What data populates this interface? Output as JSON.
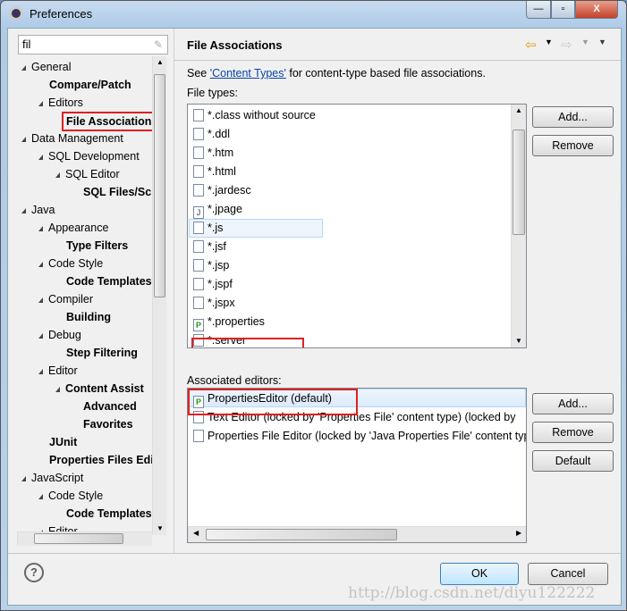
{
  "window": {
    "title": "Preferences",
    "minimize": "—",
    "maximize": "▫",
    "close": "X"
  },
  "filter": {
    "value": "fil"
  },
  "tree": [
    {
      "label": "General",
      "level": 0,
      "arrow": true,
      "bold": false
    },
    {
      "label": "Compare/Patch",
      "level": 1,
      "arrow": false,
      "bold": true
    },
    {
      "label": "Editors",
      "level": 1,
      "arrow": true,
      "bold": false
    },
    {
      "label": "File Associations",
      "level": 2,
      "arrow": false,
      "bold": true,
      "selected": true
    },
    {
      "label": "Data Management",
      "level": 0,
      "arrow": true,
      "bold": false
    },
    {
      "label": "SQL Development",
      "level": 1,
      "arrow": true,
      "bold": false
    },
    {
      "label": "SQL Editor",
      "level": 2,
      "arrow": true,
      "bold": false
    },
    {
      "label": "SQL Files/Scripts",
      "level": 3,
      "arrow": false,
      "bold": true
    },
    {
      "label": "Java",
      "level": 0,
      "arrow": true,
      "bold": false
    },
    {
      "label": "Appearance",
      "level": 1,
      "arrow": true,
      "bold": false
    },
    {
      "label": "Type Filters",
      "level": 2,
      "arrow": false,
      "bold": true
    },
    {
      "label": "Code Style",
      "level": 1,
      "arrow": true,
      "bold": false
    },
    {
      "label": "Code Templates",
      "level": 2,
      "arrow": false,
      "bold": true
    },
    {
      "label": "Compiler",
      "level": 1,
      "arrow": true,
      "bold": false
    },
    {
      "label": "Building",
      "level": 2,
      "arrow": false,
      "bold": true
    },
    {
      "label": "Debug",
      "level": 1,
      "arrow": true,
      "bold": false
    },
    {
      "label": "Step Filtering",
      "level": 2,
      "arrow": false,
      "bold": true
    },
    {
      "label": "Editor",
      "level": 1,
      "arrow": true,
      "bold": false
    },
    {
      "label": "Content Assist",
      "level": 2,
      "arrow": true,
      "bold": true
    },
    {
      "label": "Advanced",
      "level": 3,
      "arrow": false,
      "bold": true
    },
    {
      "label": "Favorites",
      "level": 3,
      "arrow": false,
      "bold": true
    },
    {
      "label": "JUnit",
      "level": 1,
      "arrow": false,
      "bold": true
    },
    {
      "label": "Properties Files Editor",
      "level": 1,
      "arrow": false,
      "bold": true
    },
    {
      "label": "JavaScript",
      "level": 0,
      "arrow": true,
      "bold": false
    },
    {
      "label": "Code Style",
      "level": 1,
      "arrow": true,
      "bold": false
    },
    {
      "label": "Code Templates",
      "level": 2,
      "arrow": false,
      "bold": true
    },
    {
      "label": "Editor",
      "level": 1,
      "arrow": true,
      "bold": false
    }
  ],
  "page": {
    "title": "File Associations",
    "desc_pre": "See ",
    "desc_link": "'Content Types'",
    "desc_post": " for content-type based file associations.",
    "file_types_label": "File types:",
    "file_types": [
      {
        "label": "*.class without source",
        "icon": "class-file-icon"
      },
      {
        "label": "*.ddl",
        "icon": "ddl-file-icon"
      },
      {
        "label": "*.htm",
        "icon": "html-file-icon"
      },
      {
        "label": "*.html",
        "icon": "html-file-icon"
      },
      {
        "label": "*.jardesc",
        "icon": "jar-file-icon"
      },
      {
        "label": "*.jpage",
        "icon": "jpage-file-icon"
      },
      {
        "label": "*.js",
        "icon": "js-file-icon"
      },
      {
        "label": "*.jsf",
        "icon": "file-icon"
      },
      {
        "label": "*.jsp",
        "icon": "file-icon"
      },
      {
        "label": "*.jspf",
        "icon": "file-icon"
      },
      {
        "label": "*.jspx",
        "icon": "file-icon"
      },
      {
        "label": "*.properties",
        "icon": "properties-file-icon"
      },
      {
        "label": "*.server",
        "icon": "server-file-icon"
      }
    ],
    "add": "Add...",
    "remove": "Remove",
    "editors_label": "Associated editors:",
    "editors": [
      {
        "label": "PropertiesEditor (default)",
        "icon": "properties-editor-icon"
      },
      {
        "label": "Text Editor (locked by 'Properties File' content type) (locked by",
        "icon": "text-editor-icon"
      },
      {
        "label": "Properties File Editor (locked by 'Java Properties File' content type)",
        "icon": "text-editor-icon"
      }
    ],
    "editors_add": "Add...",
    "editors_remove": "Remove",
    "editors_default": "Default"
  },
  "footer": {
    "help": "?",
    "ok": "OK",
    "cancel": "Cancel"
  },
  "watermark": "http://blog.csdn.net/diyu122222"
}
